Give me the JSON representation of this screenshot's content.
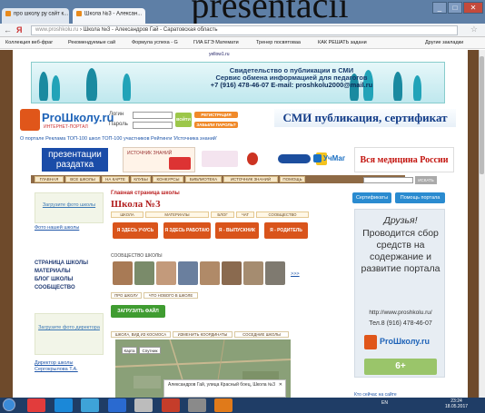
{
  "overlay_title": "presentacii",
  "browser": {
    "tabs": [
      {
        "label": "про школу ру сайт к..."
      },
      {
        "label": "Школа №3 - Алексан..."
      }
    ],
    "window_controls": [
      "_",
      "□",
      "✕"
    ],
    "address": "www.proshkolu.ru › Школа №3 - Александров Гай - Саратовская область",
    "address_host": "www.proshkolu.ru",
    "address_rest": " › Школа №3 - Александров Гай - Саратовская область",
    "nav_back": "←",
    "nav_fwd": "Я",
    "star": "☆",
    "bookmarks": [
      "Коллекция веб-фраг",
      "Рекомендуемые сай",
      "Формула успеха - G",
      "ГИА ЕГЭ Математи",
      "Тренер посвятоваa",
      "КАК РЕШАТЬ задани"
    ],
    "bookmarks_other": "Другие закладки"
  },
  "ad_banner": {
    "domain": "yellow1.ru",
    "line1": "Свидетельство о публикации в СМИ",
    "line2": "Сервис обмена информацией для педагогов",
    "line3": "+7 (916) 478-46-07 E-mail: proshkolu2000@mail.ru"
  },
  "header": {
    "logo_text": "ProШколу.ru",
    "logo_sub": "ИНТЕРНЕТ-ПОРТАЛ",
    "login_label": "Логин",
    "password_label": "Пароль",
    "login_btn": "ВОЙТИ",
    "register_btn": "РЕГИСТРАЦИЯ",
    "forgot_btn": "ЗАБЫЛИ ПАРОЛЬ?",
    "smi": "СМИ публикация, сертификат",
    "top_links": "О портале  Реклама  ТОП-100 школ  ТОП-100 участников  Рейтинги 'Источника знаний'"
  },
  "banners": {
    "presentation": "презентации раздатка",
    "source": "ИСТОЧНИК ЗНАНИЙ",
    "ychmag": "УчМаг",
    "vsemed": "Вся медицина России"
  },
  "nav": [
    "ГЛАВНАЯ",
    "ВСЕ ШКОЛЫ",
    "НА КАРТЕ",
    "КЛУБЫ",
    "КОНКУРСЫ",
    "БИБЛИОТЕКА",
    "ИСТОЧНИК ЗНАНИЙ",
    "ПОМОЩЬ"
  ],
  "search_btn": "ИСКАТЬ",
  "left": {
    "upload_photo": "Загрузите фото школы",
    "photo_link": "Фото нашей школы",
    "menu": [
      "СТРАНИЦА ШКОЛЫ",
      "МАТЕРИАЛЫ",
      "БЛОГ ШКОЛЫ",
      "СООБЩЕСТВО"
    ],
    "upload_director": "Загрузите фото директора",
    "director_label": "Директор школы",
    "director_name": "Сергокрылова Т.А."
  },
  "main": {
    "crumb": "Главная страница школы",
    "title": "Школа №3",
    "subtabs": [
      "ШКОЛА",
      "МАТЕРИАЛЫ",
      "БЛОГ",
      "ЧАТ",
      "СООБЩЕСТВО"
    ],
    "buttons": [
      "Я ЗДЕСЬ УЧУСЬ",
      "Я ЗДЕСЬ РАБОТАЮ",
      "Я - ВЫПУСКНИК",
      "Я - РОДИТЕЛЬ"
    ],
    "community_header": "СООБЩЕСТВО ШКОЛЫ",
    "more": ">>>",
    "minitabs": [
      "ПРО ШКОЛУ",
      "ЧТО НОВОГО В ШКОЛЕ"
    ],
    "upload_file": "ЗАГРУЗИТЬ ФАЙЛ",
    "map_tabs": [
      "ШКОЛА, ВИД ИЗ КОСМОСА",
      "ИЗМЕНИТЬ КООРДИНАТЫ",
      "СОСЕДНИЕ ШКОЛЫ"
    ],
    "map_btn1": "Карта",
    "map_btn2": "Спутник",
    "map_popup": "Александров Гай, улица Красный боец, Школа №3",
    "map_close": "✕"
  },
  "right": {
    "btn_cert": "Сертификаты",
    "btn_help": "Помощь портала",
    "friends": "Друзья!",
    "body": "Проводится сбор средств на содержание и развитие портала",
    "url": "http://www.proshkolu.ru/",
    "tel": "Тел.8 (916) 478-46-07",
    "logo": "ProШколу.ru",
    "age": "6+",
    "who_online": "Кто сейчас на сайте"
  },
  "taskbar": {
    "tray": "EN",
    "time": "23:24",
    "date": "18.05.2017"
  },
  "colors": {
    "frame_brown": "#6e4a2b",
    "accent_orange": "#d9541b",
    "link_blue": "#1e55a8",
    "title_red": "#b21f1f"
  }
}
